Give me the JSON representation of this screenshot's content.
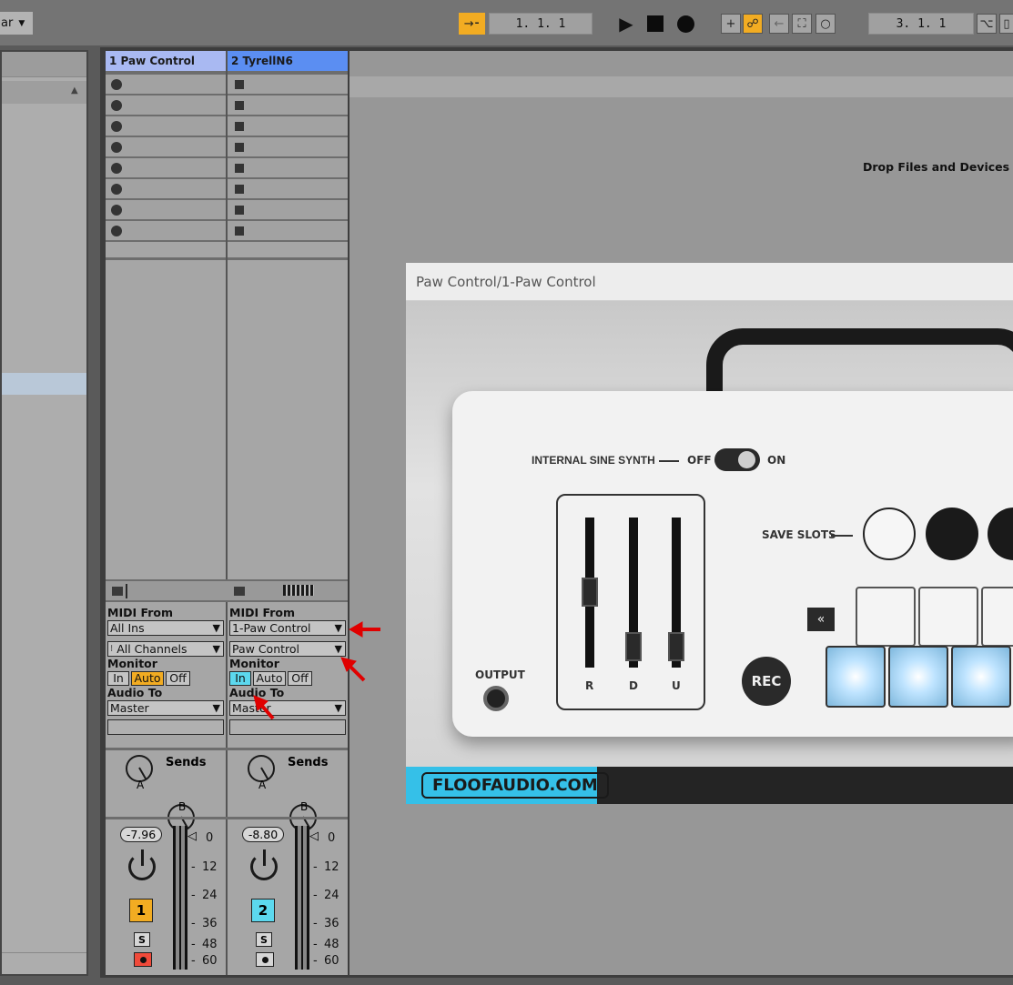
{
  "transport": {
    "left_menu": "ar",
    "position": "1.  1.  1",
    "loop_length": "3.  1.  1"
  },
  "tracks": [
    {
      "name": "1 Paw Control",
      "color": "#a9b9f2",
      "io": {
        "midi_from_label": "MIDI From",
        "midi_from": "All Ins",
        "channel": "All Channels",
        "monitor_label": "Monitor",
        "monitor_in": "In",
        "monitor_auto": "Auto",
        "monitor_off": "Off",
        "audio_to_label": "Audio To",
        "audio_to": "Master"
      },
      "sends_label": "Sends",
      "send_a": "A",
      "send_b": "B",
      "volume": "-7.96",
      "number": "1",
      "number_color": "#f2ac22",
      "solo": "S"
    },
    {
      "name": "2 TyrellN6",
      "color": "#5b8ef2",
      "io": {
        "midi_from_label": "MIDI From",
        "midi_from": "1-Paw Control",
        "channel": "Paw Control",
        "monitor_label": "Monitor",
        "monitor_in": "In",
        "monitor_auto": "Auto",
        "monitor_off": "Off",
        "audio_to_label": "Audio To",
        "audio_to": "Master"
      },
      "sends_label": "Sends",
      "send_a": "A",
      "send_b": "B",
      "volume": "-8.80",
      "number": "2",
      "number_color": "#5cd8ee",
      "solo": "S"
    }
  ],
  "meter_ticks": [
    "0",
    "12",
    "24",
    "36",
    "48",
    "60"
  ],
  "drop_hint": "Drop Files and Devices H",
  "plugin": {
    "window_title": "Paw Control/1-Paw Control",
    "synth_label": "INTERNAL SINE SYNTH",
    "off_label": "OFF",
    "on_label": "ON",
    "save_slots_label": "SAVE SLOTS",
    "fader_labels": [
      "R",
      "D",
      "U"
    ],
    "output_label": "OUTPUT",
    "rec_label": "REC",
    "brand": "FLOOFAUDIO.COM"
  }
}
